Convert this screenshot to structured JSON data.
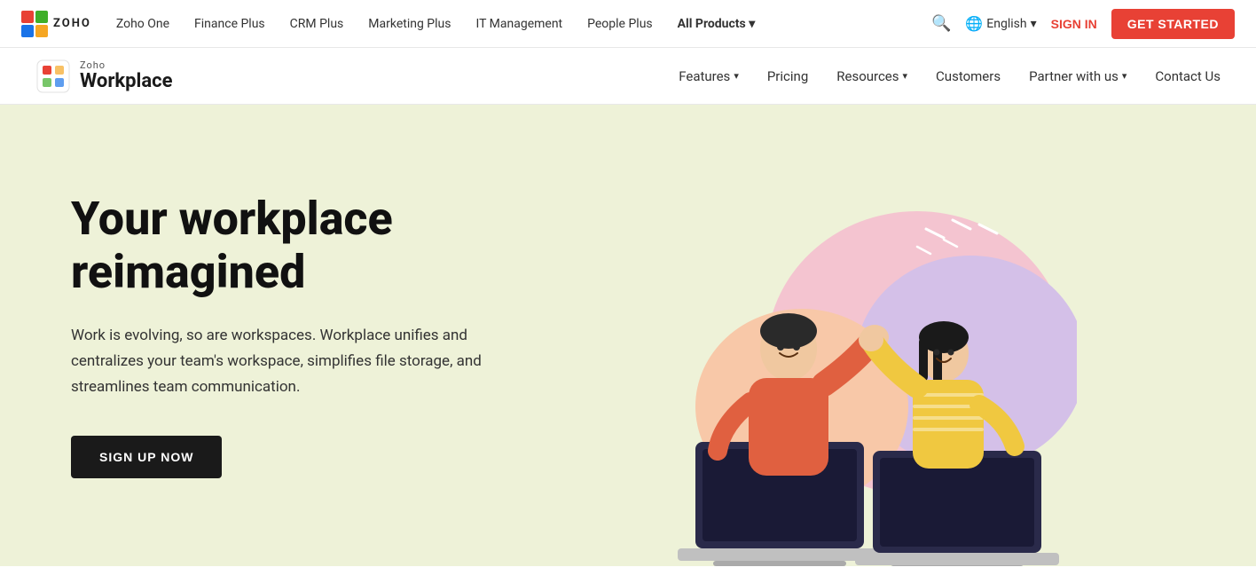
{
  "top_nav": {
    "logo_text": "ZOHO",
    "links": [
      {
        "label": "Zoho One",
        "id": "zoho-one"
      },
      {
        "label": "Finance Plus",
        "id": "finance-plus"
      },
      {
        "label": "CRM Plus",
        "id": "crm-plus"
      },
      {
        "label": "Marketing Plus",
        "id": "marketing-plus"
      },
      {
        "label": "IT Management",
        "id": "it-management"
      },
      {
        "label": "People Plus",
        "id": "people-plus"
      },
      {
        "label": "All Products",
        "id": "all-products",
        "bold": true,
        "has_arrow": true
      }
    ],
    "language": "English",
    "sign_in": "SIGN IN",
    "get_started": "GET STARTED"
  },
  "secondary_nav": {
    "brand_label": "Zoho",
    "product_name": "Workplace",
    "links": [
      {
        "label": "Features",
        "has_dropdown": true
      },
      {
        "label": "Pricing",
        "has_dropdown": false
      },
      {
        "label": "Resources",
        "has_dropdown": true
      },
      {
        "label": "Customers",
        "has_dropdown": false
      },
      {
        "label": "Partner with us",
        "has_dropdown": true
      },
      {
        "label": "Contact Us",
        "has_dropdown": false
      }
    ]
  },
  "hero": {
    "title": "Your workplace reimagined",
    "description": "Work is evolving, so are workspaces. Workplace unifies and centralizes your team's workspace, simplifies file storage, and streamlines team communication.",
    "cta_button": "SIGN UP NOW"
  },
  "icons": {
    "search": "🔍",
    "globe": "🌐",
    "chevron_down": "▾"
  }
}
